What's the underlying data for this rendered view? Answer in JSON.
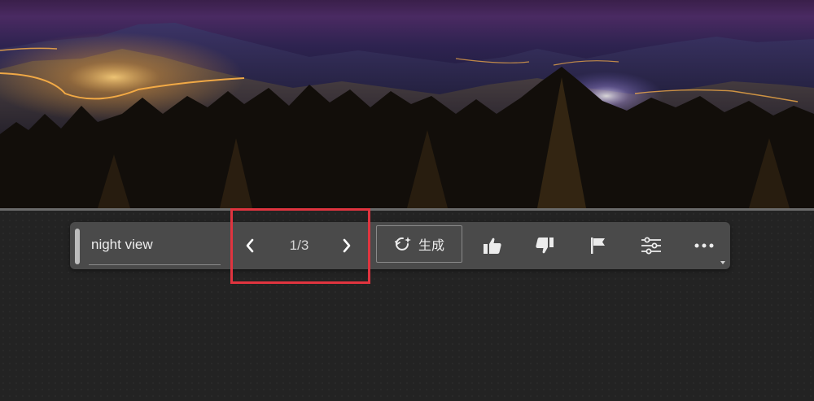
{
  "prompt": {
    "value": "night view"
  },
  "navigation": {
    "counter": "1/3"
  },
  "generate": {
    "label": "生成"
  },
  "icons": {
    "prev": "chevron-left-icon",
    "next": "chevron-right-icon",
    "generate": "sparkle-refresh-icon",
    "like": "thumbs-up-icon",
    "dislike": "thumbs-down-icon",
    "flag": "flag-icon",
    "settings": "sliders-icon",
    "more": "ellipsis-icon"
  },
  "colors": {
    "highlight": "#e0343f",
    "toolbar": "#4a4a4a",
    "canvas": "#232323"
  }
}
